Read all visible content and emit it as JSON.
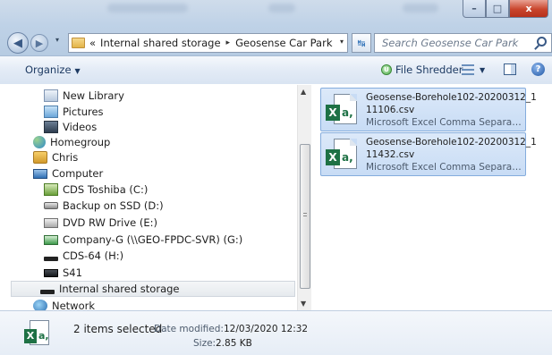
{
  "window": {
    "controls": {
      "minimize": "–",
      "maximize": "□",
      "close": "x"
    }
  },
  "nav": {
    "back_glyph": "◀",
    "forward_glyph": "▶"
  },
  "address": {
    "overflow": "«",
    "crumbs": [
      "Internal shared storage",
      "Geosense Car Park"
    ],
    "separator": "▸",
    "dropdown": "▾"
  },
  "search": {
    "placeholder": "Search Geosense Car Park"
  },
  "toolbar": {
    "organize": "Organize",
    "caret": "▼",
    "shredder": "File Shredder",
    "shredder_glyph": "U",
    "help_glyph": "?"
  },
  "sidebar": {
    "items": [
      {
        "label": "New Library",
        "icon": "library-icon"
      },
      {
        "label": "Pictures",
        "icon": "pictures-icon"
      },
      {
        "label": "Videos",
        "icon": "videos-icon"
      },
      {
        "label": "Homegroup",
        "icon": "homegroup-icon"
      },
      {
        "label": "Chris",
        "icon": "user-folder-icon"
      },
      {
        "label": "Computer",
        "icon": "computer-icon"
      },
      {
        "label": "CDS Toshiba (C:)",
        "icon": "system-drive-icon"
      },
      {
        "label": "Backup on SSD (D:)",
        "icon": "drive-icon"
      },
      {
        "label": "DVD RW Drive (E:)",
        "icon": "dvd-drive-icon"
      },
      {
        "label": "Company-G (\\\\GEO-FPDC-SVR) (G:)",
        "icon": "network-drive-icon"
      },
      {
        "label": "CDS-64 (H:)",
        "icon": "drive-icon"
      },
      {
        "label": "S41",
        "icon": "phone-icon"
      },
      {
        "label": "Internal shared storage",
        "icon": "storage-icon"
      },
      {
        "label": "Network",
        "icon": "network-icon"
      }
    ]
  },
  "scrollbar": {
    "up": "▲",
    "down": "▼"
  },
  "files": [
    {
      "name_line1": "Geosense-Borehole102-20200312_1",
      "name_line2": "11106.csv",
      "type": "Microsoft Excel Comma Separate...",
      "icon_letter": "X",
      "icon_suffix": "a,"
    },
    {
      "name_line1": "Geosense-Borehole102-20200312_1",
      "name_line2": "11432.csv",
      "type": "Microsoft Excel Comma Separate...",
      "icon_letter": "X",
      "icon_suffix": "a,"
    }
  ],
  "details": {
    "icon_letter": "X",
    "icon_suffix": "a,",
    "count": "2 items selected",
    "modified_label": "Date modified:",
    "modified_value": "12/03/2020 12:32",
    "size_label": "Size:",
    "size_value": "2.85 KB"
  }
}
